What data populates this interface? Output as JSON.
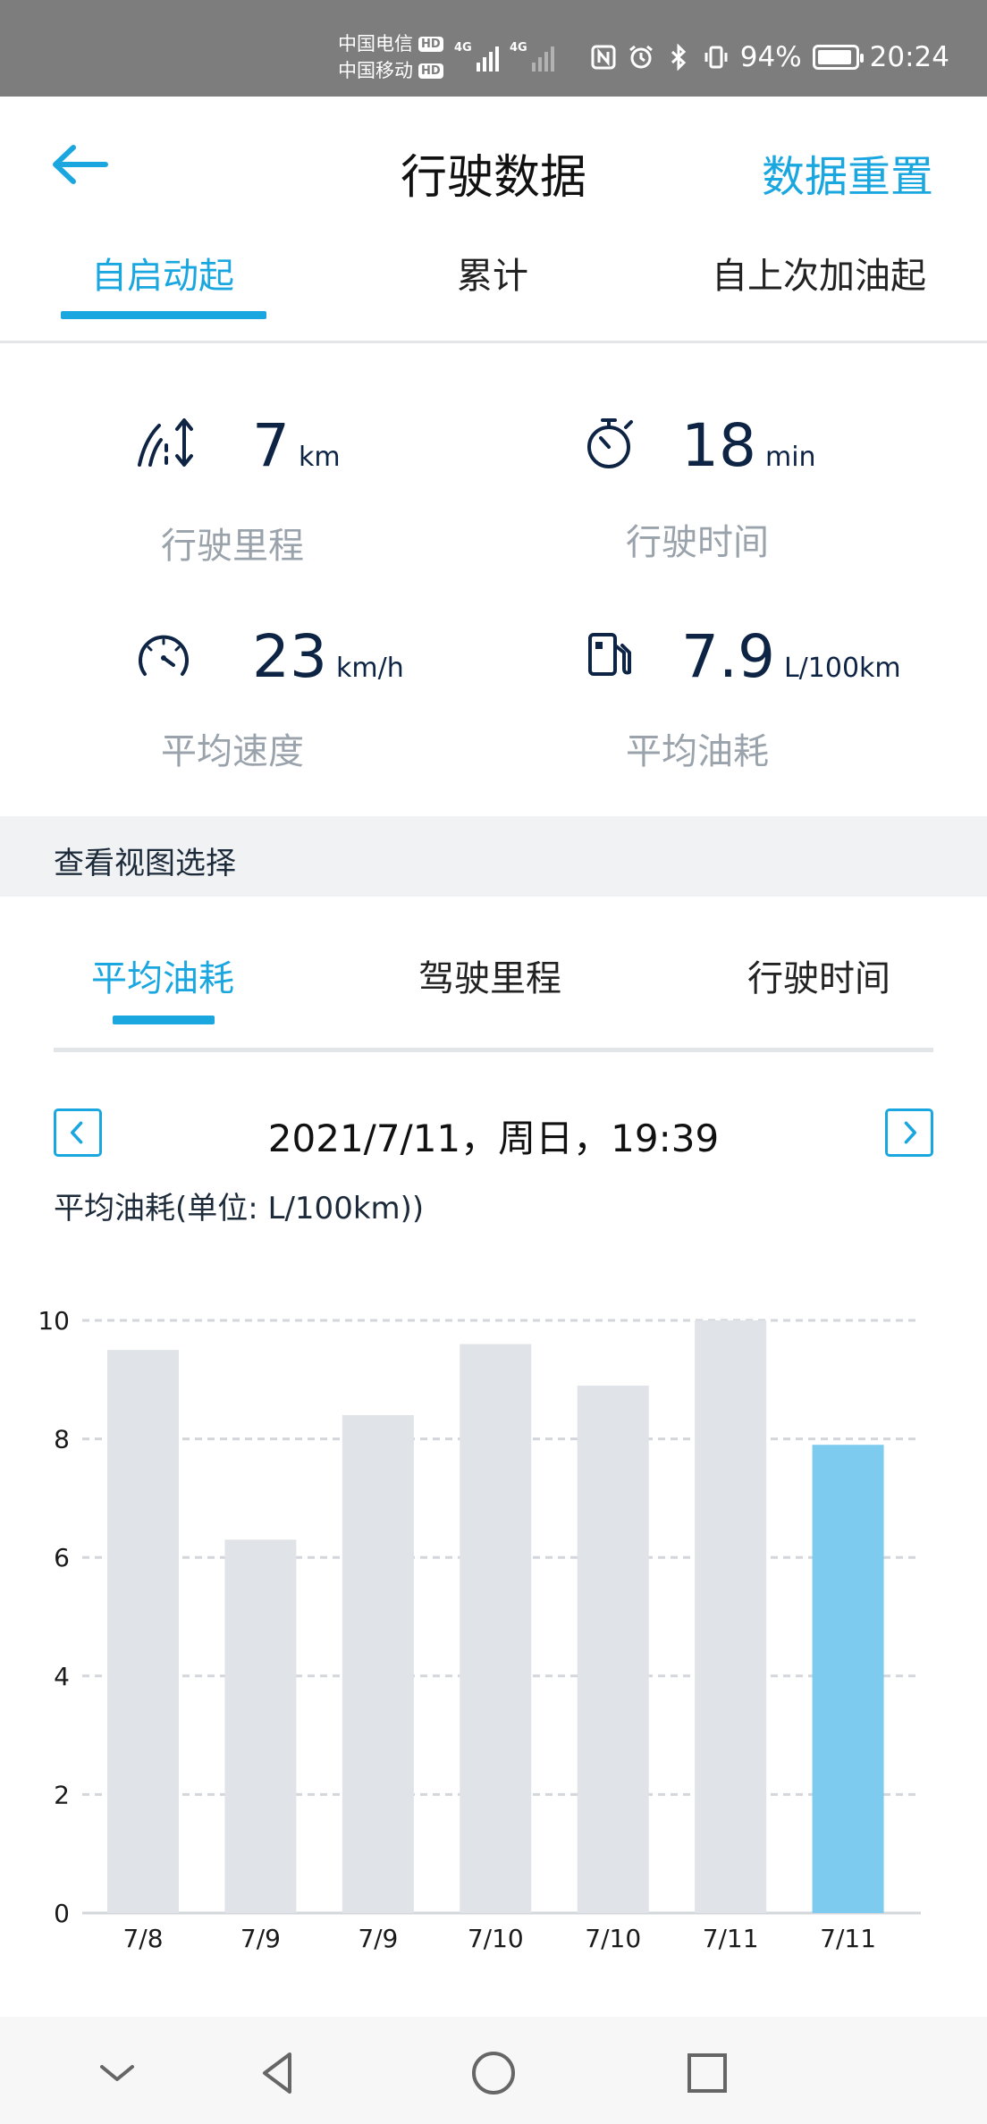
{
  "status_bar": {
    "carrier1": "中国电信",
    "carrier2": "中国移动",
    "hd": "HD",
    "net1": "4G",
    "net2": "4G",
    "battery": "94%",
    "time": "20:24"
  },
  "header": {
    "title": "行驶数据",
    "reset_label": "数据重置"
  },
  "top_tabs": [
    "自启动起",
    "累计",
    "自上次加油起"
  ],
  "stats": {
    "distance": {
      "value": "7",
      "unit": "km",
      "label": "行驶里程"
    },
    "time": {
      "value": "18",
      "unit": "min",
      "label": "行驶时间"
    },
    "speed": {
      "value": "23",
      "unit": "km/h",
      "label": "平均速度"
    },
    "fuel": {
      "value": "7.9",
      "unit": "L/100km",
      "label": "平均油耗"
    }
  },
  "section_title": "查看视图选择",
  "view_tabs": [
    "平均油耗",
    "驾驶里程",
    "行驶时间"
  ],
  "date_text": "2021/7/11，周日，19:39",
  "unit_label": "平均油耗(单位: L/100km))",
  "colors": {
    "accent": "#1aa7e0",
    "bar": "#e0e3e7",
    "bar_selected": "#7dcbee"
  },
  "chart_data": {
    "type": "bar",
    "categories": [
      "7/8",
      "7/9",
      "7/9",
      "7/10",
      "7/10",
      "7/11",
      "7/11"
    ],
    "values": [
      9.5,
      6.3,
      8.4,
      9.6,
      8.9,
      10,
      7.9
    ],
    "selected_index": 6,
    "ylim": [
      0,
      10
    ],
    "yticks": [
      0,
      2,
      4,
      6,
      8,
      10
    ],
    "grid": true,
    "title": "",
    "xlabel": "",
    "ylabel": ""
  },
  "nav_icons": [
    "chevron-down-icon",
    "back-triangle-icon",
    "home-circle-icon",
    "recent-square-icon"
  ]
}
